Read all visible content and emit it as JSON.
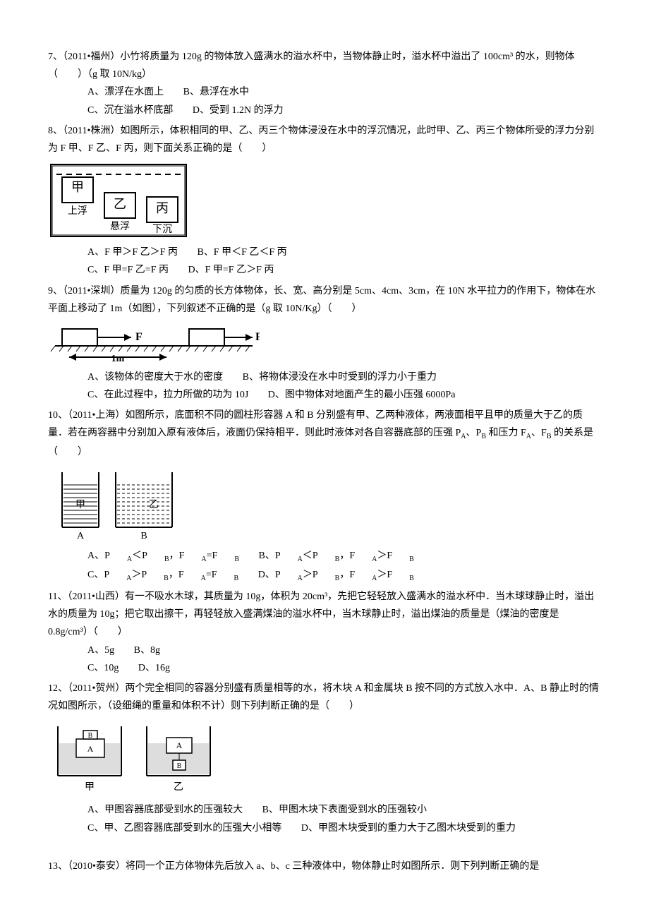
{
  "q7": {
    "stem": "7、（2011•福州）小竹将质量为 120g 的物体放入盛满水的溢水杯中，当物体静止时，溢水杯中溢出了 100cm³ 的水，则物体（　　）（g 取 10N/kg）",
    "A": "A、漂浮在水面上",
    "B": "B、悬浮在水中",
    "C": "C、沉在溢水杯底部",
    "D": "D、受到 1.2N 的浮力"
  },
  "q8": {
    "stem": "8、（2011•株洲）如图所示，体积相同的甲、乙、丙三个物体浸没在水中的浮沉情况，此时甲、乙、丙三个物体所受的浮力分别为 F 甲、F 乙、F 丙，则下面关系正确的是（　　）",
    "fig": {
      "jia": "甲",
      "shang": "上浮",
      "yi": "乙",
      "xuan": "悬浮",
      "bing": "丙",
      "xia": "下沉"
    },
    "A": "A、F 甲＞F 乙＞F 丙",
    "B": "B、F 甲＜F 乙＜F 丙",
    "C": "C、F 甲=F 乙=F 丙",
    "D": "D、F 甲=F 乙＞F 丙"
  },
  "q9": {
    "stem": "9、（2011•深圳）质量为 120g 的匀质的长方体物体，长、宽、高分别是 5cm、4cm、3cm，在 10N 水平拉力的作用下，物体在水平面上移动了 1m（如图），下列叙述不正确的是（g 取 10N/Kg）（　　）",
    "fig": {
      "F1": "F",
      "F2": "F",
      "dist": "1m"
    },
    "A": "A、该物体的密度大于水的密度",
    "B": "B、将物体浸没在水中时受到的浮力小于重力",
    "C": "C、在此过程中，拉力所做的功为 10J",
    "D": "D、图中物体对地面产生的最小压强 6000Pa"
  },
  "q10": {
    "stem_a": "10、（2011•上海）如图所示，底面积不同的圆柱形容器 A 和 B 分别盛有甲、乙两种液体，两液面相平且甲的质量大于乙的质量．若在两容器中分别加入原有液体后，液面仍保持相平．则此时液体对各自容器底部的压强 P",
    "stem_b": "、P",
    "stem_c": " 和压力 F",
    "stem_d": "、F",
    "stem_e": " 的关系是（　　）",
    "sA": "A",
    "sB": "B",
    "fig": {
      "jia": "甲",
      "yi": "乙",
      "labA": "A",
      "labB": "B"
    },
    "Aa": "A、P",
    "Ab": "＜P",
    "Ac": "，F",
    "Ad": "=F",
    "Ba": "B、P",
    "Bb": "＜P",
    "Bc": "，F",
    "Bd": "＞F",
    "Ca": "C、P",
    "Cb": "＞P",
    "Cc": "，F",
    "Cd": "=F",
    "Da": "D、P",
    "Db": "＞P",
    "Dc": "，F",
    "Dd": "＞F"
  },
  "q11": {
    "stem": "11、（2011•山西）有一不吸水木球，其质量为 10g，体积为 20cm³，先把它轻轻放入盛满水的溢水杯中．当木球球静止时，溢出水的质量为 10g；把它取出擦干，再轻轻放入盛满煤油的溢水杯中，当木球静止时，溢出煤油的质量是（煤油的密度是 0.8g/cm³）（　　）",
    "A": "A、5g",
    "B": "B、8g",
    "C": "C、10g",
    "D": "D、16g"
  },
  "q12": {
    "stem": "12、（2011•贺州）两个完全相同的容器分别盛有质量相等的水，将木块 A 和金属块 B 按不同的方式放入水中．A、B 静止时的情况如图所示，（设细绳的重量和体积不计）则下列判断正确的是（　　）",
    "fig": {
      "Bt": "B",
      "At": "A",
      "Ab": "A",
      "Bb": "B",
      "jia": "甲",
      "yi": "乙"
    },
    "A": "A、甲图容器底部受到水的压强较大",
    "B": "B、甲图木块下表面受到水的压强较小",
    "C": "C、甲、乙图容器底部受到水的压强大小相等",
    "D": "D、甲图木块受到的重力大于乙图木块受到的重力"
  },
  "q13": {
    "stem": "13、（2010•泰安）将同一个正方体物体先后放入 a、b、c 三种液体中，物体静止时如图所示．则下列判断正确的是"
  }
}
